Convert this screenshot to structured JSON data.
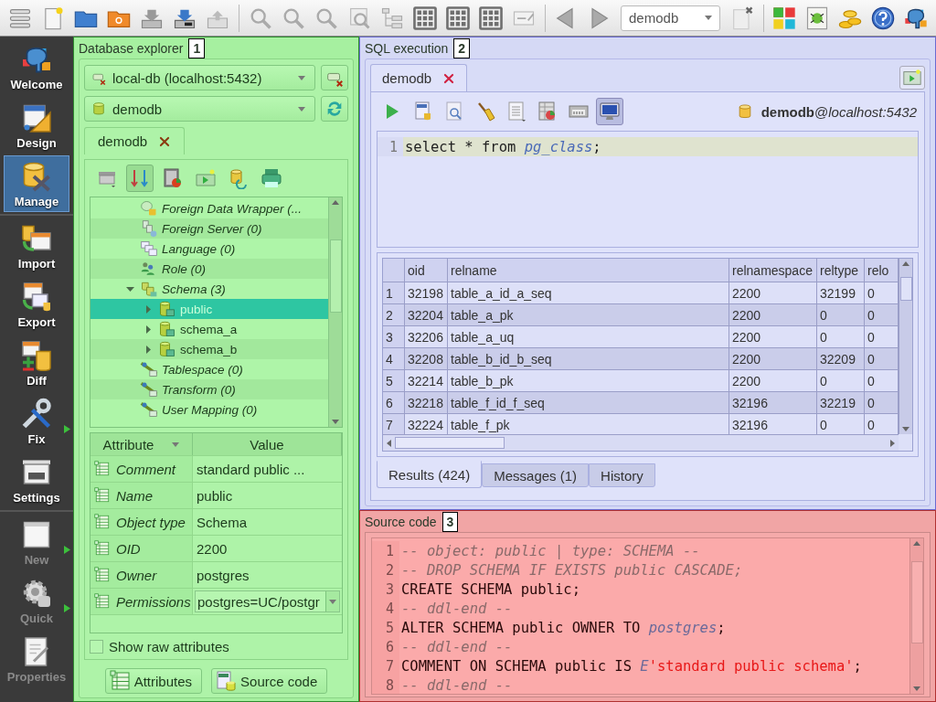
{
  "toolbar": {
    "database": "demodb"
  },
  "sidebar": {
    "items": [
      {
        "label": "Welcome",
        "selected": false,
        "disabled": false,
        "submenu": false,
        "separator_after": false
      },
      {
        "label": "Design",
        "selected": false,
        "disabled": false,
        "submenu": false,
        "separator_after": false
      },
      {
        "label": "Manage",
        "selected": true,
        "disabled": false,
        "submenu": false,
        "separator_after": true
      },
      {
        "label": "Import",
        "selected": false,
        "disabled": false,
        "submenu": false,
        "separator_after": false
      },
      {
        "label": "Export",
        "selected": false,
        "disabled": false,
        "submenu": false,
        "separator_after": false
      },
      {
        "label": "Diff",
        "selected": false,
        "disabled": false,
        "submenu": false,
        "separator_after": false
      },
      {
        "label": "Fix",
        "selected": false,
        "disabled": false,
        "submenu": true,
        "separator_after": false
      },
      {
        "label": "Settings",
        "selected": false,
        "disabled": false,
        "submenu": false,
        "separator_after": true
      },
      {
        "label": "New",
        "selected": false,
        "disabled": true,
        "submenu": true,
        "separator_after": false
      },
      {
        "label": "Quick",
        "selected": false,
        "disabled": true,
        "submenu": true,
        "separator_after": false
      },
      {
        "label": "Properties",
        "selected": false,
        "disabled": true,
        "submenu": false,
        "separator_after": false
      }
    ]
  },
  "explorer": {
    "title": "Database explorer",
    "badge": "1",
    "connection": "local-db (localhost:5432)",
    "database": "demodb",
    "tab": {
      "label": "demodb"
    },
    "toolbar_buttons": [
      {
        "pressed": false
      },
      {
        "pressed": true
      },
      {
        "pressed": false
      },
      {
        "pressed": false
      },
      {
        "pressed": false
      },
      {
        "pressed": false
      }
    ],
    "tree": [
      {
        "label": "Foreign Data Wrapper (...",
        "kind": "group",
        "selected": false
      },
      {
        "label": "Foreign Server (0)",
        "kind": "group",
        "selected": false
      },
      {
        "label": "Language (0)",
        "kind": "group",
        "selected": false
      },
      {
        "label": "Role (0)",
        "kind": "group",
        "selected": false
      },
      {
        "label": "Schema (3)",
        "kind": "group",
        "selected": false,
        "expanded": true,
        "children": [
          {
            "label": "public",
            "kind": "object",
            "selected": true,
            "expanded": false
          },
          {
            "label": "schema_a",
            "kind": "object",
            "selected": false,
            "expanded": false
          },
          {
            "label": "schema_b",
            "kind": "object",
            "selected": false,
            "expanded": false
          }
        ]
      },
      {
        "label": "Tablespace (0)",
        "kind": "group",
        "selected": false
      },
      {
        "label": "Transform (0)",
        "kind": "group",
        "selected": false
      },
      {
        "label": "User Mapping (0)",
        "kind": "group",
        "selected": false
      }
    ],
    "attributes": {
      "columns": [
        "Attribute",
        "Value"
      ],
      "rows": [
        {
          "attribute": "Comment",
          "value": "standard public ...",
          "kind": "text"
        },
        {
          "attribute": "Name",
          "value": "public",
          "kind": "text"
        },
        {
          "attribute": "Object type",
          "value": "Schema",
          "kind": "text"
        },
        {
          "attribute": "OID",
          "value": "2200",
          "kind": "text"
        },
        {
          "attribute": "Owner",
          "value": "postgres",
          "kind": "text"
        },
        {
          "attribute": "Permissions",
          "value": "postgres=UC/postgr",
          "kind": "dropdown"
        }
      ]
    },
    "show_raw": {
      "label": "Show raw attributes",
      "checked": false
    },
    "buttons": [
      "Attributes",
      "Source code"
    ]
  },
  "sql": {
    "title": "SQL execution",
    "badge": "2",
    "tab": {
      "label": "demodb"
    },
    "toolbar_buttons": [
      {
        "pressed": false
      },
      {
        "pressed": false
      },
      {
        "pressed": false
      },
      {
        "pressed": false
      },
      {
        "pressed": false
      },
      {
        "pressed": false
      },
      {
        "pressed": false
      },
      {
        "pressed": true
      }
    ],
    "connection": "**demodb**@*localhost:5432*",
    "editor": {
      "lines": [
        {
          "number": "1",
          "current": true,
          "segments": [
            {
              "kind": "plain",
              "text": "select * from "
            },
            {
              "kind": "identifier",
              "text": "pg_class"
            },
            {
              "kind": "plain",
              "text": ";"
            }
          ]
        }
      ]
    },
    "results": {
      "columns": [
        "oid",
        "relname",
        "relnamespace",
        "reltype",
        "relo"
      ],
      "rows": [
        {
          "number": "1",
          "cells": [
            "32198",
            "table_a_id_a_seq",
            "2200",
            "32199",
            "0"
          ]
        },
        {
          "number": "2",
          "cells": [
            "32204",
            "table_a_pk",
            "2200",
            "0",
            "0"
          ]
        },
        {
          "number": "3",
          "cells": [
            "32206",
            "table_a_uq",
            "2200",
            "0",
            "0"
          ]
        },
        {
          "number": "4",
          "cells": [
            "32208",
            "table_b_id_b_seq",
            "2200",
            "32209",
            "0"
          ]
        },
        {
          "number": "5",
          "cells": [
            "32214",
            "table_b_pk",
            "2200",
            "0",
            "0"
          ]
        },
        {
          "number": "6",
          "cells": [
            "32218",
            "table_f_id_f_seq",
            "32196",
            "32219",
            "0"
          ]
        },
        {
          "number": "7",
          "cells": [
            "32224",
            "table_f_pk",
            "32196",
            "0",
            "0"
          ]
        }
      ]
    },
    "tabs": [
      {
        "label": "Results (424)",
        "selected": true
      },
      {
        "label": "Messages (1)",
        "selected": false
      },
      {
        "label": "History",
        "selected": false
      }
    ]
  },
  "source": {
    "title": "Source code",
    "badge": "3",
    "lines": [
      {
        "number": "1",
        "segments": [
          {
            "kind": "comment",
            "text": "-- object: public | type: SCHEMA --"
          }
        ]
      },
      {
        "number": "2",
        "segments": [
          {
            "kind": "comment",
            "text": "-- DROP SCHEMA IF EXISTS public CASCADE;"
          }
        ]
      },
      {
        "number": "3",
        "segments": [
          {
            "kind": "plain",
            "text": "CREATE SCHEMA public;"
          }
        ]
      },
      {
        "number": "4",
        "segments": [
          {
            "kind": "comment",
            "text": "-- ddl-end --"
          }
        ]
      },
      {
        "number": "5",
        "segments": [
          {
            "kind": "plain",
            "text": "ALTER SCHEMA public OWNER TO "
          },
          {
            "kind": "identifier",
            "text": "postgres"
          },
          {
            "kind": "plain",
            "text": ";"
          }
        ]
      },
      {
        "number": "6",
        "segments": [
          {
            "kind": "comment",
            "text": "-- ddl-end --"
          }
        ]
      },
      {
        "number": "7",
        "segments": [
          {
            "kind": "plain",
            "text": "COMMENT ON SCHEMA public IS "
          },
          {
            "kind": "identifier",
            "text": "E"
          },
          {
            "kind": "string",
            "text": "'standard public schema'"
          },
          {
            "kind": "plain",
            "text": ";"
          }
        ]
      },
      {
        "number": "8",
        "segments": [
          {
            "kind": "comment",
            "text": "-- ddl-end --"
          }
        ]
      }
    ]
  }
}
